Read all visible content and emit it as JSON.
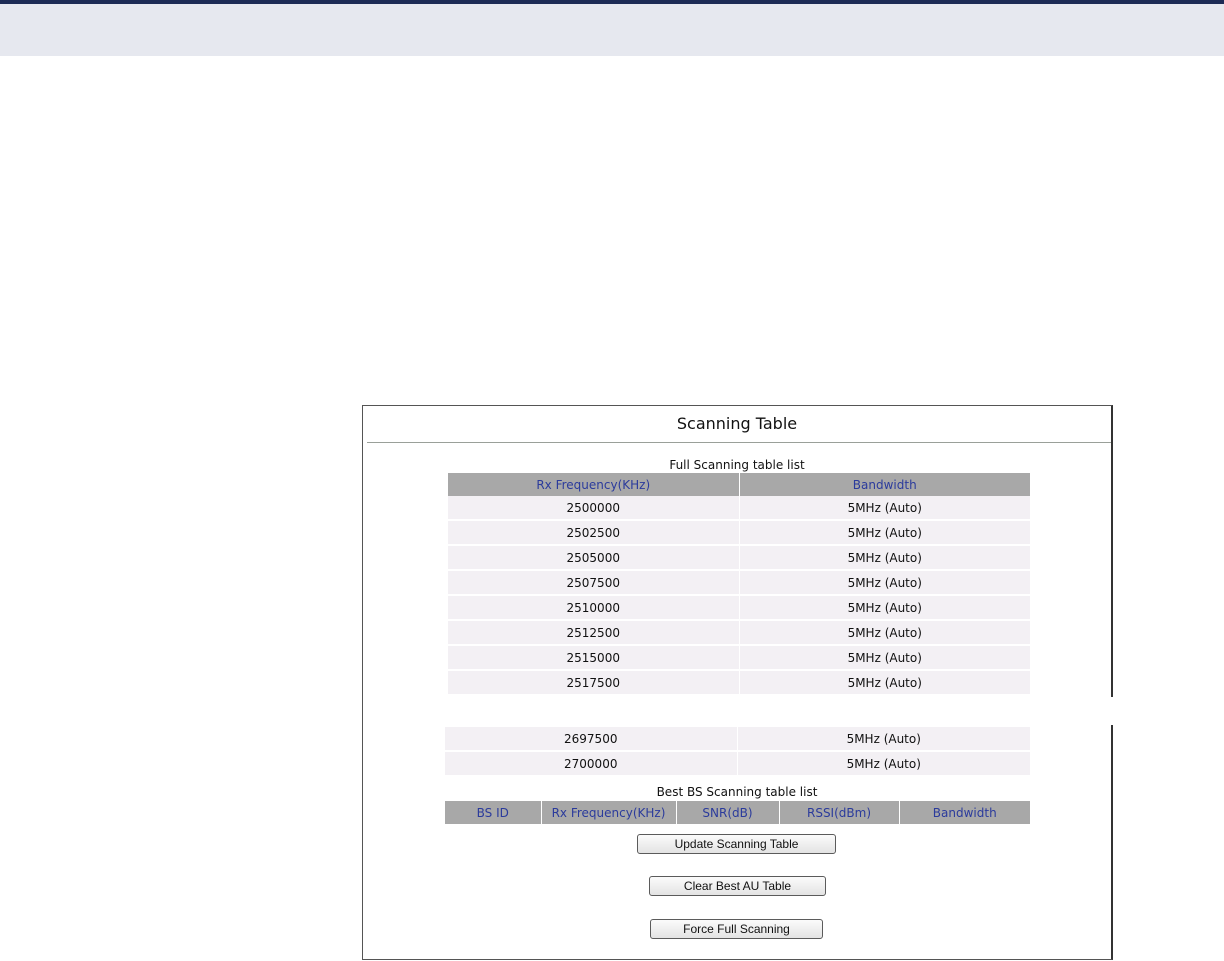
{
  "panel": {
    "title": "Scanning Table"
  },
  "full_table": {
    "caption": "Full Scanning table list",
    "columns": [
      "Rx Frequency(KHz)",
      "Bandwidth"
    ],
    "rows": [
      [
        "2500000",
        "5MHz (Auto)"
      ],
      [
        "2502500",
        "5MHz (Auto)"
      ],
      [
        "2505000",
        "5MHz (Auto)"
      ],
      [
        "2507500",
        "5MHz (Auto)"
      ],
      [
        "2510000",
        "5MHz (Auto)"
      ],
      [
        "2512500",
        "5MHz (Auto)"
      ],
      [
        "2515000",
        "5MHz (Auto)"
      ],
      [
        "2517500",
        "5MHz (Auto)"
      ]
    ],
    "tail_rows": [
      [
        "2697500",
        "5MHz (Auto)"
      ],
      [
        "2700000",
        "5MHz (Auto)"
      ]
    ]
  },
  "best_table": {
    "caption": "Best BS Scanning table list",
    "columns": [
      "BS ID",
      "Rx Frequency(KHz)",
      "SNR(dB)",
      "RSSI(dBm)",
      "Bandwidth"
    ]
  },
  "buttons": {
    "update": "Update Scanning Table",
    "clear": "Clear Best AU Table",
    "force": "Force Full Scanning"
  },
  "colors": {
    "header_bg": "#a8a8a8",
    "header_text": "#2b3b9c",
    "row_bg": "#f3f0f4",
    "top_bar_border": "#1c2b55"
  }
}
